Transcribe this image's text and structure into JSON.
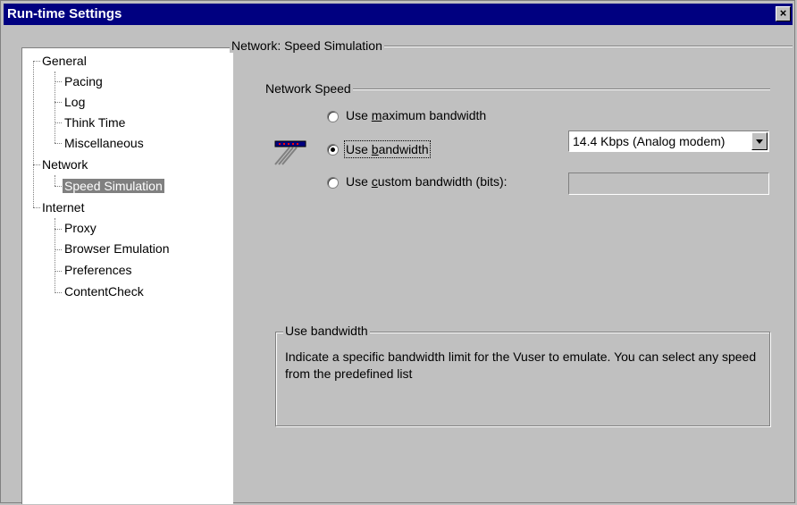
{
  "window": {
    "title": "Run-time Settings",
    "close_glyph": "×"
  },
  "tree": {
    "items": [
      {
        "label": "General"
      },
      {
        "label": "Pacing"
      },
      {
        "label": "Log"
      },
      {
        "label": "Think Time"
      },
      {
        "label": "Miscellaneous"
      },
      {
        "label": "Network"
      },
      {
        "label": "Speed Simulation",
        "selected": true
      },
      {
        "label": "Internet"
      },
      {
        "label": "Proxy"
      },
      {
        "label": "Browser Emulation"
      },
      {
        "label": "Preferences"
      },
      {
        "label": "ContentCheck"
      }
    ]
  },
  "panel": {
    "title": "Network: Speed Simulation",
    "network_speed": {
      "title": "Network Speed",
      "options": [
        {
          "pre": "Use ",
          "accel": "m",
          "post": "aximum bandwidth",
          "checked": false
        },
        {
          "pre": "Use ",
          "accel": "b",
          "post": "andwidth",
          "checked": true
        },
        {
          "pre": "Use ",
          "accel": "c",
          "post": "ustom bandwidth (bits):",
          "checked": false
        }
      ],
      "bandwidth_select": "14.4 Kbps (Analog modem)",
      "custom_bits_value": ""
    },
    "description": {
      "title": "Use bandwidth",
      "text": "Indicate a specific bandwidth limit for the Vuser to emulate. You can select any speed from the predefined list"
    }
  },
  "icons": {
    "modem": "modem-icon"
  }
}
